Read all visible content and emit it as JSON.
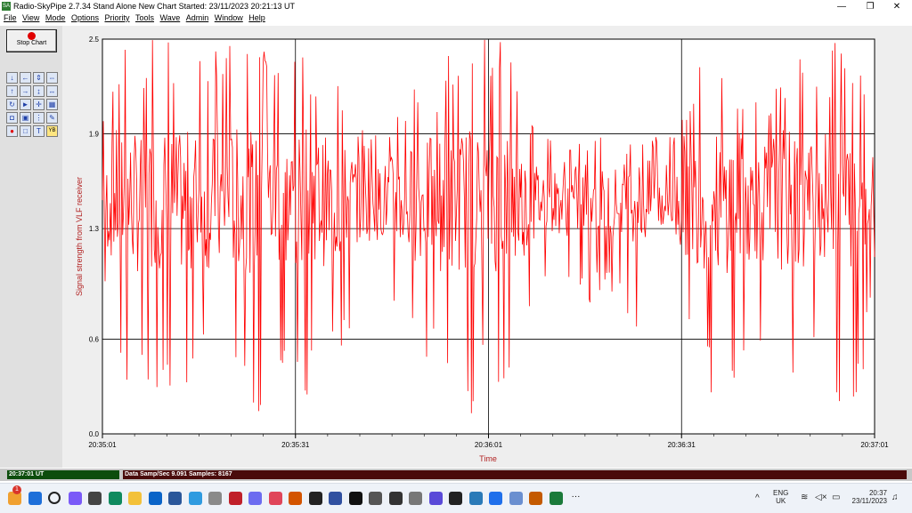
{
  "window": {
    "app_icon": "SA",
    "title": "Radio-SkyPipe  2.7.34  Stand Alone  New Chart Started: 23/11/2023 20:21:13 UT",
    "controls": [
      "minimize-icon",
      "restore-icon",
      "close-icon"
    ]
  },
  "menu": [
    "File",
    "View",
    "Mode",
    "Options",
    "Priority",
    "Tools",
    "Wave",
    "Admin",
    "Window",
    "Help"
  ],
  "toolbar": {
    "stop_label": "Stop Chart",
    "tools": [
      {
        "icon": "arrow-down-icon",
        "glyph": "↓"
      },
      {
        "icon": "arrow-left-icon",
        "glyph": "←"
      },
      {
        "icon": "expand-vertical-icon",
        "glyph": "⇕"
      },
      {
        "icon": "fast-forward-icon",
        "glyph": "⇔"
      },
      {
        "icon": "arrow-up-icon",
        "glyph": "↑"
      },
      {
        "icon": "arrow-right-icon",
        "glyph": "→"
      },
      {
        "icon": "compress-vertical-icon",
        "glyph": "↨"
      },
      {
        "icon": "compress-horizontal-icon",
        "glyph": "↔"
      },
      {
        "icon": "refresh-icon",
        "glyph": "↻"
      },
      {
        "icon": "flag-icon",
        "glyph": "►"
      },
      {
        "icon": "crosshair-icon",
        "glyph": "✛"
      },
      {
        "icon": "grid-icon",
        "glyph": "▦"
      },
      {
        "icon": "screenshot-icon",
        "glyph": "◘"
      },
      {
        "icon": "select-icon",
        "glyph": "▣"
      },
      {
        "icon": "split-icon",
        "glyph": "⋮"
      },
      {
        "icon": "pen-icon",
        "glyph": "✎"
      },
      {
        "icon": "record-icon",
        "glyph": "●"
      },
      {
        "icon": "blank-icon",
        "glyph": "□"
      },
      {
        "icon": "text-icon",
        "glyph": "T"
      },
      {
        "icon": "yb-icon",
        "glyph": "YB"
      }
    ]
  },
  "chart_data": {
    "type": "line",
    "title": "",
    "xlabel": "Time",
    "ylabel": "Signal strength from VLF receiver",
    "ylim": [
      0.0,
      2.5
    ],
    "yticks": [
      "2.5",
      "1.9",
      "1.3",
      "0.6",
      "0.0"
    ],
    "ytick_values": [
      2.5,
      1.9,
      1.3,
      0.6,
      0.0
    ],
    "xticks": [
      "20:35:01",
      "20:35:31",
      "20:36:01",
      "20:36:31",
      "20:37:01"
    ],
    "grid": true,
    "series": [
      {
        "color": "#ff0000",
        "x": [
          "20:35:01",
          "20:35:04",
          "20:35:07",
          "20:35:10",
          "20:35:13",
          "20:35:16",
          "20:35:19",
          "20:35:22",
          "20:35:25",
          "20:35:28",
          "20:35:31",
          "20:35:34",
          "20:35:37",
          "20:35:40",
          "20:35:43",
          "20:35:46",
          "20:35:49",
          "20:35:52",
          "20:35:55",
          "20:35:58",
          "20:36:01",
          "20:36:04",
          "20:36:07",
          "20:36:10",
          "20:36:13",
          "20:36:16",
          "20:36:19",
          "20:36:22",
          "20:36:25",
          "20:36:28",
          "20:36:31",
          "20:36:34",
          "20:36:37",
          "20:36:40",
          "20:36:43",
          "20:36:46",
          "20:36:49",
          "20:36:52",
          "20:36:55",
          "20:36:58",
          "20:37:01"
        ],
        "min": [
          0.9,
          0.1,
          0.4,
          0.1,
          0.0,
          0.5,
          0.0,
          0.4,
          0.0,
          0.4,
          0.0,
          0.4,
          0.4,
          0.7,
          0.9,
          0.8,
          0.5,
          0.4,
          0.2,
          0.0,
          0.3,
          0.0,
          0.7,
          1.0,
          0.9,
          0.8,
          0.9,
          0.8,
          0.6,
          0.9,
          0.6,
          0.4,
          0.1,
          0.3,
          0.5,
          0.2,
          0.3,
          0.6,
          0.2,
          0.0,
          1.0
        ],
        "max": [
          2.0,
          2.5,
          2.5,
          2.5,
          2.5,
          2.4,
          2.5,
          2.5,
          2.5,
          2.4,
          2.5,
          2.2,
          2.3,
          2.0,
          1.9,
          2.0,
          2.2,
          2.1,
          2.5,
          2.5,
          2.5,
          2.5,
          2.0,
          1.9,
          1.8,
          1.9,
          1.9,
          1.8,
          1.9,
          1.9,
          2.0,
          2.4,
          2.5,
          2.2,
          2.1,
          2.3,
          2.5,
          2.2,
          2.5,
          2.5,
          1.8
        ],
        "baseline": [
          1.45,
          1.5,
          1.45,
          1.5,
          1.45,
          1.5,
          1.45,
          1.5,
          1.45,
          1.5,
          1.45,
          1.5,
          1.45,
          1.5,
          1.45,
          1.5,
          1.45,
          1.5,
          1.45,
          1.5,
          1.45,
          1.5,
          1.45,
          1.5,
          1.45,
          1.5,
          1.45,
          1.5,
          1.45,
          1.5,
          1.45,
          1.5,
          1.45,
          1.5,
          1.45,
          1.5,
          1.45,
          1.5,
          1.45,
          1.5,
          1.45
        ]
      }
    ]
  },
  "status": {
    "time": "20:37:01 UT",
    "data": "Data Samp/Sec 9.091   Samples:  8167"
  },
  "taskbar": {
    "notification_badge": "1",
    "lang_line1": "ENG",
    "lang_line2": "UK",
    "clock_time": "20:37",
    "clock_date": "23/11/2023",
    "apps": [
      "weather-icon",
      "start-icon",
      "search-icon",
      "copilot-icon",
      "task-view-icon",
      "edge-icon",
      "file-explorer-icon",
      "outlook-icon",
      "word-icon",
      "remote-desktop-icon",
      "notes-icon",
      "journal-icon",
      "settings-gear-icon",
      "capture-icon",
      "fc-icon",
      "ase-icon",
      "radio-app-icon",
      "audacity-icon",
      "spectrum-icon",
      "fx-icon",
      "mirror-icon",
      "crystal-icon",
      "window-icon",
      "notepad-icon",
      "bug-icon",
      "audio-app-icon",
      "headphones-icon",
      "skypipe-icon",
      "more-icon"
    ]
  }
}
